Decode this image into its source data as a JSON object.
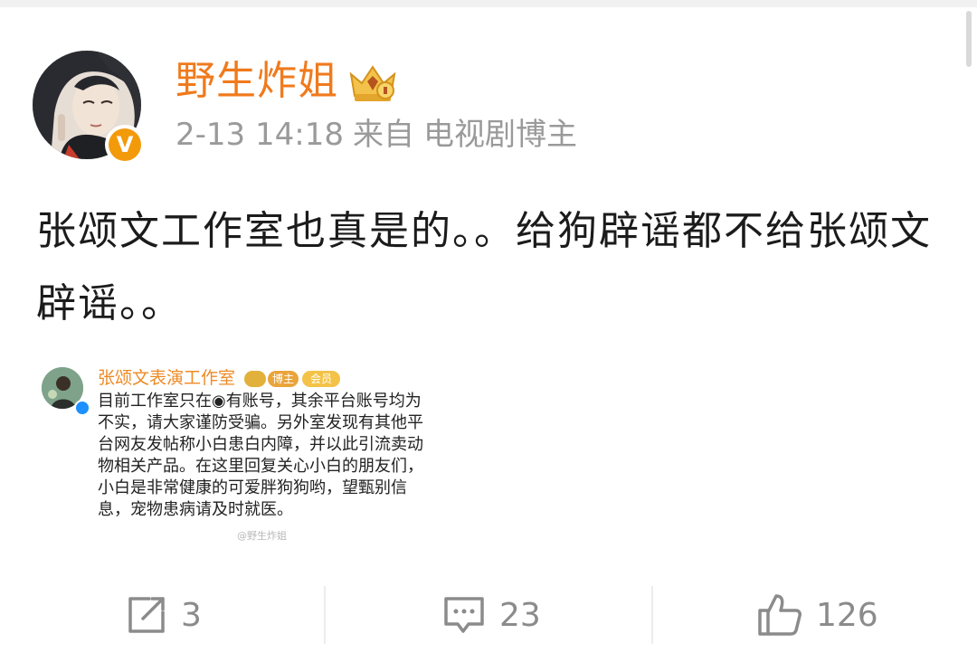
{
  "post": {
    "username": "野生炸姐",
    "date": "2-13 14:18",
    "source_prefix": "来自",
    "source": "电视剧博主",
    "badge_letter": "V",
    "text": "张颂文工作室也真是的。。给狗辟谣都不给张颂文辟谣。。"
  },
  "embed": {
    "name": "张颂文表演工作室",
    "tag1": "博主",
    "tag2": "会员",
    "text": "目前工作室只在◉有账号，其余平台账号均为不实，请大家谨防受骗。另外室发现有其他平台网友发帖称小白患白内障，并以此引流卖动物相关产品。在这里回复关心小白的朋友们，小白是非常健康的可爱胖狗狗哟，望甄别信息，宠物患病请及时就医。",
    "watermark": "@野生炸姐"
  },
  "actions": {
    "repost_count": "3",
    "comment_count": "23",
    "like_count": "126"
  },
  "colors": {
    "username": "#f07a1c",
    "meta": "#9a9a9a",
    "text": "#1b1b1b",
    "icon": "#8b8b8b",
    "vbadge": "#f39a0b"
  },
  "icons": {
    "crown": "crown-icon",
    "repost": "repost-icon",
    "comment": "comment-icon",
    "like": "like-icon"
  }
}
